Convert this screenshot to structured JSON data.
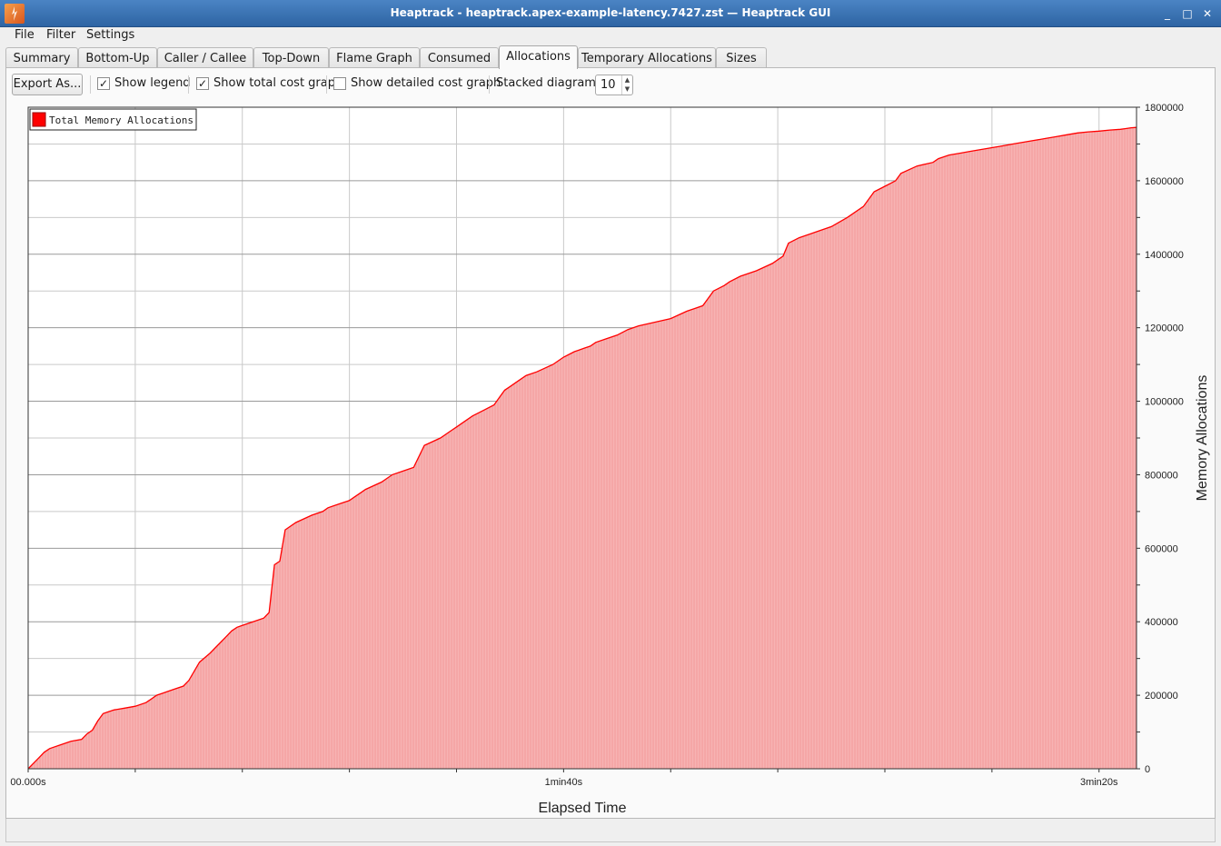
{
  "window": {
    "title": "Heaptrack - heaptrack.apex-example-latency.7427.zst — Heaptrack GUI",
    "minimize": "_",
    "maximize": "□",
    "close": "✕"
  },
  "menu": [
    "File",
    "Filter",
    "Settings"
  ],
  "tabs": [
    {
      "label": "Summary"
    },
    {
      "label": "Bottom-Up"
    },
    {
      "label": "Caller / Callee"
    },
    {
      "label": "Top-Down"
    },
    {
      "label": "Flame Graph"
    },
    {
      "label": "Consumed"
    },
    {
      "label": "Allocations",
      "active": true
    },
    {
      "label": "Temporary Allocations"
    },
    {
      "label": "Sizes"
    }
  ],
  "toolbar": {
    "export_label": "Export As...",
    "show_legend": {
      "label": "Show legend",
      "checked": true
    },
    "show_total": {
      "label": "Show total cost graph",
      "checked": true
    },
    "show_detailed": {
      "label": "Show detailed cost graph",
      "checked": false
    },
    "stacked_label": "Stacked diagrams:",
    "stacked_value": "10",
    "check_glyph": "✓"
  },
  "chart_data": {
    "type": "area",
    "title": "",
    "xlabel": "Elapsed Time",
    "ylabel": "Memory Allocations",
    "xlim": [
      0,
      207
    ],
    "ylim": [
      0,
      1800000
    ],
    "x_ticks": [
      {
        "value": 0,
        "label": "00.000s"
      },
      {
        "value": 100,
        "label": "1min40s"
      },
      {
        "value": 200,
        "label": "3min20s"
      }
    ],
    "y_ticks": [
      0,
      200000,
      400000,
      600000,
      800000,
      1000000,
      1200000,
      1400000,
      1600000,
      1800000
    ],
    "y_tick_labels": [
      "0",
      "200000",
      "400000",
      "600000",
      "800000",
      "1000000",
      "1200000",
      "1400000",
      "1600000",
      "1800000"
    ],
    "grid": true,
    "legend": "top-left",
    "series": [
      {
        "name": "Total Memory Allocations",
        "color": "#ff0000",
        "fill": "#f7b3b3",
        "x": [
          0,
          1,
          2,
          3,
          4,
          6,
          8,
          10,
          11,
          12,
          13,
          14,
          15,
          16,
          18,
          20,
          22,
          23,
          24,
          25,
          27,
          29,
          30,
          32,
          34,
          35,
          36,
          37,
          38,
          39,
          40,
          42,
          44,
          45,
          46,
          47,
          48,
          50,
          53,
          55,
          56,
          57,
          58,
          59,
          60,
          61,
          62,
          63,
          66,
          68,
          70,
          72,
          74,
          77,
          79,
          80,
          81,
          83,
          85,
          87,
          88,
          89,
          90,
          91,
          93,
          95,
          98,
          100,
          102,
          104,
          105,
          106,
          108,
          110,
          112,
          114,
          117,
          120,
          123,
          126,
          128,
          130,
          131,
          133,
          136,
          139,
          141,
          142,
          144,
          147,
          150,
          153,
          156,
          158,
          160,
          162,
          163,
          166,
          169,
          170,
          171,
          172,
          174,
          176,
          178,
          180,
          182,
          184,
          186,
          188,
          190,
          192,
          194,
          196,
          198,
          200,
          202,
          204,
          205,
          206,
          207
        ],
        "y": [
          0,
          15000,
          30000,
          45000,
          55000,
          65000,
          75000,
          80000,
          95000,
          105000,
          130000,
          150000,
          155000,
          160000,
          165000,
          170000,
          180000,
          190000,
          200000,
          205000,
          215000,
          225000,
          240000,
          290000,
          315000,
          330000,
          345000,
          360000,
          375000,
          385000,
          390000,
          400000,
          410000,
          425000,
          555000,
          565000,
          650000,
          670000,
          690000,
          700000,
          710000,
          715000,
          720000,
          725000,
          730000,
          740000,
          750000,
          760000,
          780000,
          800000,
          810000,
          820000,
          880000,
          900000,
          920000,
          930000,
          940000,
          960000,
          975000,
          990000,
          1010000,
          1030000,
          1040000,
          1050000,
          1070000,
          1080000,
          1100000,
          1120000,
          1135000,
          1145000,
          1150000,
          1160000,
          1170000,
          1180000,
          1195000,
          1205000,
          1215000,
          1225000,
          1245000,
          1260000,
          1300000,
          1315000,
          1325000,
          1340000,
          1355000,
          1375000,
          1395000,
          1430000,
          1445000,
          1460000,
          1475000,
          1500000,
          1530000,
          1570000,
          1585000,
          1600000,
          1620000,
          1640000,
          1650000,
          1660000,
          1665000,
          1670000,
          1675000,
          1680000,
          1685000,
          1690000,
          1695000,
          1700000,
          1705000,
          1710000,
          1715000,
          1720000,
          1725000,
          1730000,
          1733000,
          1735000,
          1738000,
          1740000,
          1742000,
          1744000,
          1745000
        ]
      }
    ]
  }
}
